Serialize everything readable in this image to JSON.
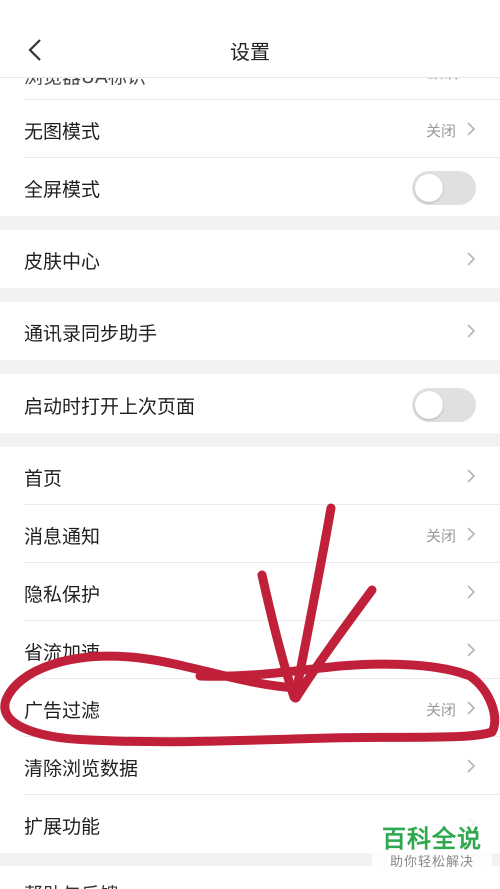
{
  "header": {
    "title": "设置"
  },
  "cut_row": {
    "label": "浏览器UA标识",
    "value": "默认"
  },
  "rows": {
    "no_image": {
      "label": "无图模式",
      "value": "关闭"
    },
    "fullscreen": {
      "label": "全屏模式"
    },
    "skin": {
      "label": "皮肤中心"
    },
    "contacts": {
      "label": "通讯录同步助手"
    },
    "restore": {
      "label": "启动时打开上次页面"
    },
    "home": {
      "label": "首页"
    },
    "notify": {
      "label": "消息通知",
      "value": "关闭"
    },
    "privacy": {
      "label": "隐私保护"
    },
    "data_saver": {
      "label": "省流加速"
    },
    "ad_filter": {
      "label": "广告过滤",
      "value": "关闭"
    },
    "clear_data": {
      "label": "清除浏览数据"
    },
    "extensions": {
      "label": "扩展功能"
    }
  },
  "bottom_cut": {
    "label": "帮助与反馈"
  },
  "toggles": {
    "fullscreen_on": false,
    "restore_on": false
  },
  "watermark": {
    "title": "百科全说",
    "subtitle": "助你轻松解决"
  },
  "colors": {
    "annotation": "#c0203a",
    "watermark": "#2fa84f",
    "toggle_off": "#e0e0e0"
  }
}
